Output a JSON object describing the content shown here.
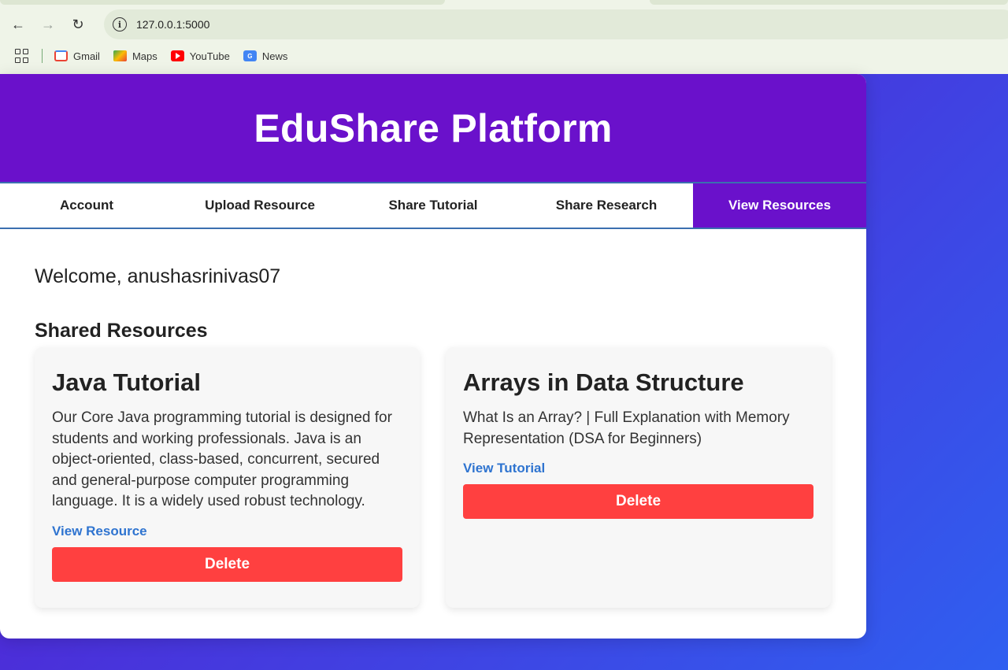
{
  "browser": {
    "url": "127.0.0.1:5000",
    "bookmarks": [
      {
        "label": "Gmail",
        "icon": "gmail-icon"
      },
      {
        "label": "Maps",
        "icon": "maps-icon"
      },
      {
        "label": "YouTube",
        "icon": "youtube-icon"
      },
      {
        "label": "News",
        "icon": "news-icon"
      }
    ]
  },
  "header": {
    "title": "EduShare Platform"
  },
  "nav": {
    "items": [
      {
        "label": "Account"
      },
      {
        "label": "Upload Resource"
      },
      {
        "label": "Share Tutorial"
      },
      {
        "label": "Share Research"
      },
      {
        "label": "View Resources",
        "active": true
      }
    ]
  },
  "main": {
    "welcome": "Welcome, anushasrinivas07",
    "section_title": "Shared Resources",
    "resources": [
      {
        "title": "Java Tutorial",
        "description": "Our Core Java programming tutorial is designed for students and working professionals. Java is an object-oriented, class-based, concurrent, secured and general-purpose computer programming language. It is a widely used robust technology.",
        "link_label": "View Resource",
        "delete_label": "Delete"
      },
      {
        "title": "Arrays in Data Structure",
        "description": "What Is an Array? | Full Explanation with Memory Representation (DSA for Beginners)",
        "link_label": "View Tutorial",
        "delete_label": "Delete"
      }
    ]
  },
  "colors": {
    "brand": "#6a11cb",
    "delete": "#ff4040",
    "link": "#2f74d0"
  }
}
